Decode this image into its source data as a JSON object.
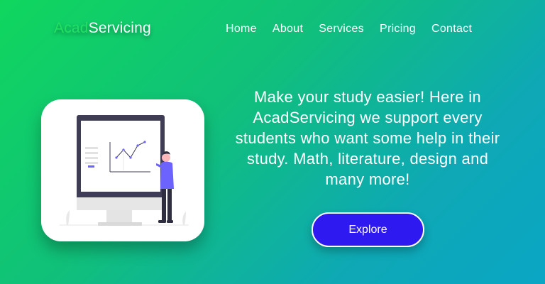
{
  "header": {
    "logo_part1": "Acad",
    "logo_part2": "Servicing",
    "nav": [
      {
        "label": "Home"
      },
      {
        "label": "About"
      },
      {
        "label": "Services"
      },
      {
        "label": "Pricing"
      },
      {
        "label": "Contact"
      }
    ]
  },
  "hero": {
    "text": "Make your study easier! Here in AcadServicing we support every students who want some help in their study. Math, literature, design and many more!",
    "button_label": "Explore"
  },
  "illustration": {
    "icon": "monitor-chart-person-illustration"
  },
  "colors": {
    "logo_accent": "#22e064",
    "button_bg": "#2e1af0",
    "gradient_start": "#10d65e",
    "gradient_end": "#0aa6c4"
  }
}
